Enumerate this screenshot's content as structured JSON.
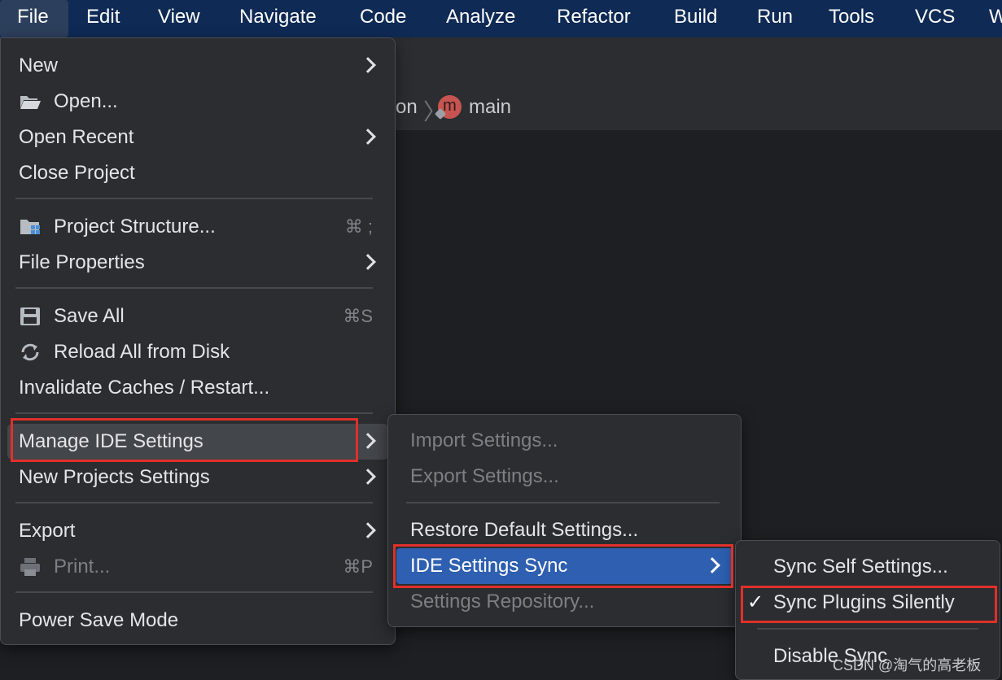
{
  "menubar": {
    "items": [
      "File",
      "Edit",
      "View",
      "Navigate",
      "Code",
      "Analyze",
      "Refactor",
      "Build",
      "Run",
      "Tools",
      "VCS",
      "W"
    ]
  },
  "breadcrumb": {
    "partial": "on",
    "badge_letter": "m",
    "method": "main"
  },
  "file_menu": {
    "new": "New",
    "open": "Open...",
    "open_recent": "Open Recent",
    "close_project": "Close Project",
    "project_structure": "Project Structure...",
    "project_structure_shortcut": "⌘ ;",
    "file_properties": "File Properties",
    "save_all": "Save All",
    "save_all_shortcut": "⌘S",
    "reload_all": "Reload All from Disk",
    "invalidate_caches": "Invalidate Caches / Restart...",
    "manage_ide_settings": "Manage IDE Settings",
    "new_projects_settings": "New Projects Settings",
    "export": "Export",
    "print": "Print...",
    "print_shortcut": "⌘P",
    "power_save_mode": "Power Save Mode"
  },
  "manage_submenu": {
    "import_settings": "Import Settings...",
    "export_settings": "Export Settings...",
    "restore_default": "Restore Default Settings...",
    "ide_settings_sync": "IDE Settings Sync",
    "settings_repository": "Settings Repository..."
  },
  "sync_submenu": {
    "sync_self": "Sync Self Settings...",
    "sync_plugins": "Sync Plugins Silently",
    "sync_plugins_checked": true,
    "check_mark": "✓",
    "disable_sync": "Disable Sync"
  },
  "watermark": "CSDN @淘气的高老板",
  "colors": {
    "menubar_bg": "#0e2a55",
    "popup_bg": "#2b2d30",
    "highlight_blue": "#2e5fb0",
    "annotation_red": "#e0302a"
  }
}
